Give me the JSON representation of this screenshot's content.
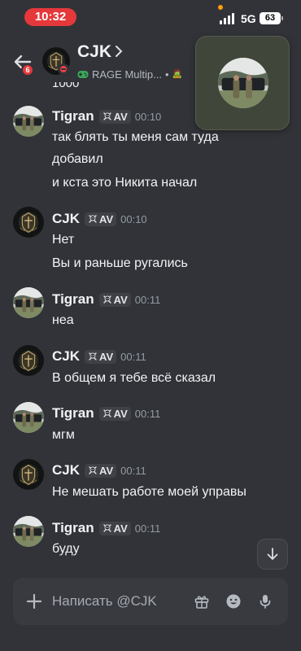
{
  "status_bar": {
    "time": "10:32",
    "network": "5G",
    "battery": "63"
  },
  "header": {
    "unread_count": "6",
    "name": "CJK",
    "activity": "RAGE Multip...",
    "activity_separator": "•",
    "activity_emoji": "🧟"
  },
  "partial_message": "1000",
  "messages": [
    {
      "author": "Tigran",
      "tag": "AV",
      "time": "00:10",
      "lines": [
        "так блять ты меня сам туда",
        "добавил",
        "и кста это Никита начал"
      ]
    },
    {
      "author": "CJK",
      "tag": "AV",
      "time": "00:10",
      "lines": [
        "Нет",
        "Вы и раньше ругались"
      ]
    },
    {
      "author": "Tigran",
      "tag": "AV",
      "time": "00:11",
      "lines": [
        "неа"
      ]
    },
    {
      "author": "CJK",
      "tag": "AV",
      "time": "00:11",
      "lines": [
        "В общем я тебе всё сказал"
      ]
    },
    {
      "author": "Tigran",
      "tag": "AV",
      "time": "00:11",
      "lines": [
        "мгм"
      ]
    },
    {
      "author": "CJK",
      "tag": "AV",
      "time": "00:11",
      "lines": [
        "Не мешать работе моей управы"
      ]
    },
    {
      "author": "Tigran",
      "tag": "AV",
      "time": "00:11",
      "lines": [
        "буду"
      ]
    }
  ],
  "composer": {
    "placeholder": "Написать @CJK"
  },
  "colors": {
    "background": "#313338",
    "composer": "#383a40",
    "badge_red": "#e5383b",
    "dnd_red": "#f23f43",
    "text_primary": "#f2f3f5",
    "text_muted": "#949ba4",
    "tag_background": "#3f4147"
  },
  "icons": {
    "back": "arrow-left-icon",
    "chevron": "chevron-right-icon",
    "game": "gamepad-icon",
    "clan_tag": "skull-icon",
    "scroll_down": "arrow-down-icon",
    "attach": "plus-icon",
    "gift": "gift-icon",
    "emoji": "emoji-icon",
    "voice": "microphone-icon"
  }
}
